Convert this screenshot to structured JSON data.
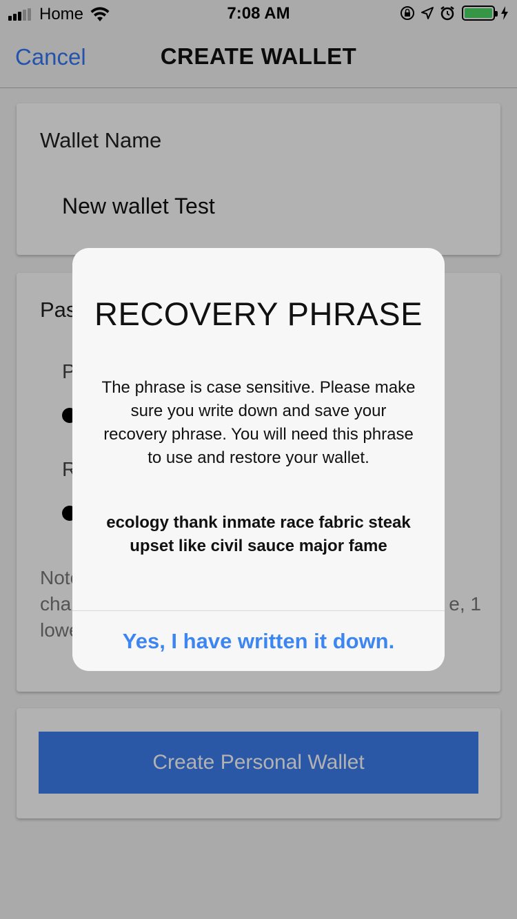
{
  "status_bar": {
    "carrier": "Home",
    "time": "7:08 AM",
    "signal_bars_filled": 3,
    "signal_bars_total": 5,
    "battery_level": 1.0,
    "battery_color": "#4cd964",
    "icons": [
      "signal-icon",
      "wifi-icon",
      "orientation-lock-icon",
      "location-icon",
      "alarm-icon",
      "battery-icon",
      "charging-icon"
    ]
  },
  "nav": {
    "cancel_label": "Cancel",
    "title": "CREATE WALLET",
    "accent_color": "#3478f6"
  },
  "wallet_name": {
    "label": "Wallet Name",
    "value": "New wallet Test"
  },
  "password_section": {
    "label": "Pas",
    "password_label": "P",
    "repeat_label": "R",
    "note_lines": [
      "Note",
      "char",
      "lowe"
    ],
    "note_tail": "e, 1"
  },
  "create_button": {
    "label": "Create Personal Wallet",
    "color": "#3d7ef0"
  },
  "dialog": {
    "title": "RECOVERY PHRASE",
    "message": "The phrase is case sensitive. Please make sure you write down and save your recovery phrase. You will need this phrase to use and restore your wallet.",
    "phrase": "ecology thank inmate race fabric steak upset like civil sauce major fame",
    "confirm_label": "Yes, I have written it down.",
    "confirm_color": "#3d86f2"
  }
}
